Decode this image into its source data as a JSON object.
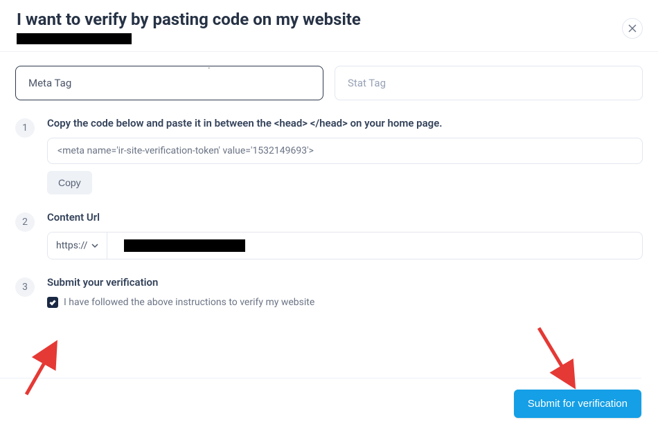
{
  "header": {
    "title": "I want to verify by pasting code on my website"
  },
  "tabs": {
    "meta": "Meta Tag",
    "stat": "Stat Tag"
  },
  "step1": {
    "num": "1",
    "title": "Copy the code below and paste it in between the <head> </head> on your home page.",
    "code": "<meta name='ir-site-verification-token' value='1532149693'>",
    "copy": "Copy"
  },
  "step2": {
    "num": "2",
    "title": "Content Url",
    "protocol": "https://"
  },
  "step3": {
    "num": "3",
    "title": "Submit your verification",
    "checkbox_label": "I have followed the above instructions to verify my website",
    "checked": true
  },
  "footer": {
    "submit": "Submit for verification"
  }
}
